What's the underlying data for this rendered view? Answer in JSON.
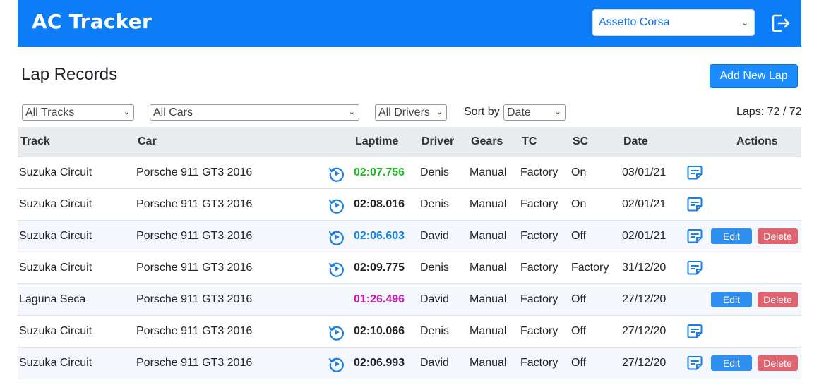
{
  "header": {
    "brand": "AC Tracker",
    "game_select": "Assetto Corsa"
  },
  "page": {
    "title": "Lap Records",
    "add_button": "Add New Lap"
  },
  "filters": {
    "track": "All Tracks",
    "car": "All Cars",
    "driver": "All Drivers",
    "sort_label": "Sort by",
    "sort": "Date",
    "laps_count": "Laps: 72 / 72"
  },
  "columns": {
    "track": "Track",
    "car": "Car",
    "laptime": "Laptime",
    "driver": "Driver",
    "gears": "Gears",
    "tc": "TC",
    "sc": "SC",
    "date": "Date",
    "actions": "Actions"
  },
  "colors": {
    "navbar": "#0d7cf7",
    "laptime_green": "#22b822",
    "laptime_blue": "#1a7fe6",
    "laptime_magenta": "#c41aa8",
    "edit": "#2d8ff0",
    "delete": "#e06470"
  },
  "rows": [
    {
      "track": "Suzuka Circuit",
      "car": "Porsche 911 GT3 2016",
      "laptime": "02:07.756",
      "laptime_color": "green",
      "driver": "Denis",
      "gears": "Manual",
      "tc": "Factory",
      "sc": "On",
      "date": "03/01/21",
      "replay": true,
      "notes": true,
      "actions": false
    },
    {
      "track": "Suzuka Circuit",
      "car": "Porsche 911 GT3 2016",
      "laptime": "02:08.016",
      "laptime_color": "black",
      "driver": "Denis",
      "gears": "Manual",
      "tc": "Factory",
      "sc": "On",
      "date": "02/01/21",
      "replay": true,
      "notes": true,
      "actions": false
    },
    {
      "track": "Suzuka Circuit",
      "car": "Porsche 911 GT3 2016",
      "laptime": "02:06.603",
      "laptime_color": "blue",
      "driver": "David",
      "gears": "Manual",
      "tc": "Factory",
      "sc": "Off",
      "date": "02/01/21",
      "replay": true,
      "notes": true,
      "actions": true
    },
    {
      "track": "Suzuka Circuit",
      "car": "Porsche 911 GT3 2016",
      "laptime": "02:09.775",
      "laptime_color": "black",
      "driver": "Denis",
      "gears": "Manual",
      "tc": "Factory",
      "sc": "Factory",
      "date": "31/12/20",
      "replay": true,
      "notes": true,
      "actions": false
    },
    {
      "track": "Laguna Seca",
      "car": "Porsche 911 GT3 2016",
      "laptime": "01:26.496",
      "laptime_color": "magenta",
      "driver": "David",
      "gears": "Manual",
      "tc": "Factory",
      "sc": "Off",
      "date": "27/12/20",
      "replay": false,
      "notes": false,
      "actions": true
    },
    {
      "track": "Suzuka Circuit",
      "car": "Porsche 911 GT3 2016",
      "laptime": "02:10.066",
      "laptime_color": "black",
      "driver": "Denis",
      "gears": "Manual",
      "tc": "Factory",
      "sc": "Off",
      "date": "27/12/20",
      "replay": true,
      "notes": true,
      "actions": false
    },
    {
      "track": "Suzuka Circuit",
      "car": "Porsche 911 GT3 2016",
      "laptime": "02:06.993",
      "laptime_color": "black",
      "driver": "David",
      "gears": "Manual",
      "tc": "Factory",
      "sc": "Off",
      "date": "27/12/20",
      "replay": true,
      "notes": true,
      "actions": true
    }
  ],
  "action_labels": {
    "edit": "Edit",
    "delete": "Delete"
  },
  "icons": {
    "replay": "replay-icon",
    "notes": "notes-icon",
    "logout": "logout-icon"
  }
}
